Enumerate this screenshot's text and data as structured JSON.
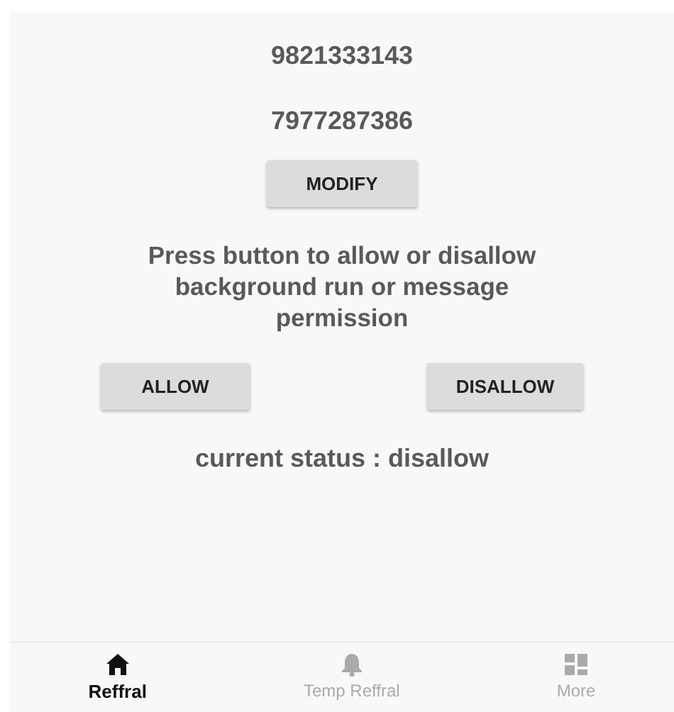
{
  "numbers": [
    "9821333143",
    "7977287386"
  ],
  "modify_button": "MODIFY",
  "message": "Press button to allow or disallow background run or message permission",
  "permission_buttons": [
    "ALLOW",
    "DISALLOW"
  ],
  "status": "current status : disallow",
  "bottom_nav": [
    {
      "label": "Reffral",
      "kind": "home",
      "selected": true
    },
    {
      "label": "Temp Reffral",
      "kind": "bell",
      "selected": false
    },
    {
      "label": "More",
      "kind": "grid",
      "selected": false
    }
  ]
}
